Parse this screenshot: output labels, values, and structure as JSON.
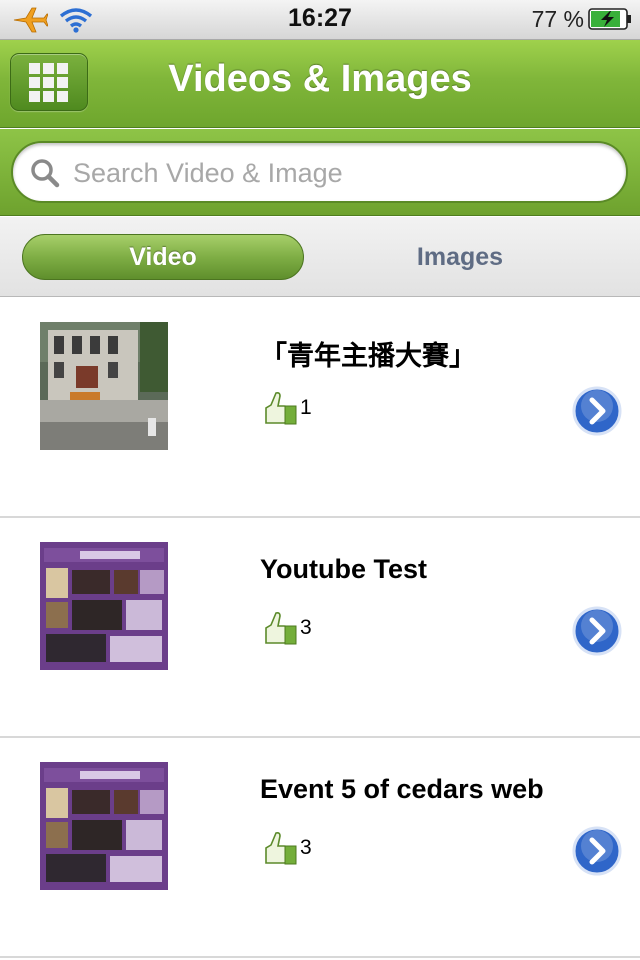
{
  "status_bar": {
    "time": "16:27",
    "battery": "77 %",
    "icons": [
      "airplane-icon",
      "wifi-icon",
      "battery-charging-icon"
    ]
  },
  "nav": {
    "title": "Videos & Images",
    "menu_icon": "grid-icon"
  },
  "search": {
    "placeholder": "Search Video & Image",
    "value": ""
  },
  "segments": {
    "video": "Video",
    "images": "Images",
    "selected": "Video"
  },
  "items": [
    {
      "title": "「青年主播大賽」",
      "likes": "1",
      "thumb": "building-photo"
    },
    {
      "title": "Youtube Test",
      "likes": "3",
      "thumb": "purple-poster"
    },
    {
      "title": "Event 5 of cedars web",
      "likes": "3",
      "thumb": "purple-poster"
    }
  ],
  "colors": {
    "nav_green": "#80b63a",
    "accent_blue": "#2f66c9",
    "segment_inactive": "#5f6c84"
  }
}
